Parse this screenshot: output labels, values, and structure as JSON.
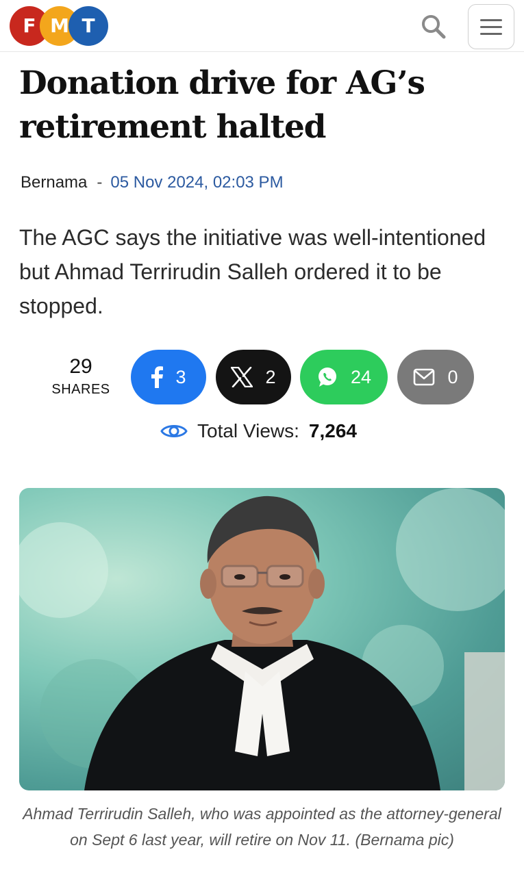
{
  "header": {
    "logo": {
      "letters": [
        "F",
        "M",
        "T"
      ],
      "alt": "FMT"
    },
    "search_icon": "search-icon",
    "menu_icon": "hamburger-menu-icon"
  },
  "article": {
    "title": "Donation drive for AG’s retirement halted",
    "author": "Bernama",
    "separator": "-",
    "date": "05 Nov 2024, 02:03 PM",
    "lede": "The AGC says the initiative was well-intentioned but Ahmad Terrirudin Salleh ordered it to be stopped."
  },
  "shares": {
    "total": "29",
    "label": "SHARES",
    "buttons": [
      {
        "network": "facebook",
        "icon": "facebook-icon",
        "count": "3",
        "color": "#1f78f0"
      },
      {
        "network": "x",
        "icon": "x-icon",
        "count": "2",
        "color": "#141414"
      },
      {
        "network": "whatsapp",
        "icon": "whatsapp-icon",
        "count": "24",
        "color": "#2dcc5c"
      },
      {
        "network": "email",
        "icon": "mail-icon",
        "count": "0",
        "color": "#7a7a7a"
      }
    ]
  },
  "views": {
    "label": "Total Views:",
    "count": "7,264",
    "icon": "eye-icon"
  },
  "photo": {
    "caption": "Ahmad Terrirudin Salleh, who was appointed as the attorney-general on Sept 6 last year, will retire on Nov 11.  (Bernama pic)"
  },
  "colors": {
    "byline_date": "#2c5aa0",
    "eye_icon": "#2b78e4"
  }
}
